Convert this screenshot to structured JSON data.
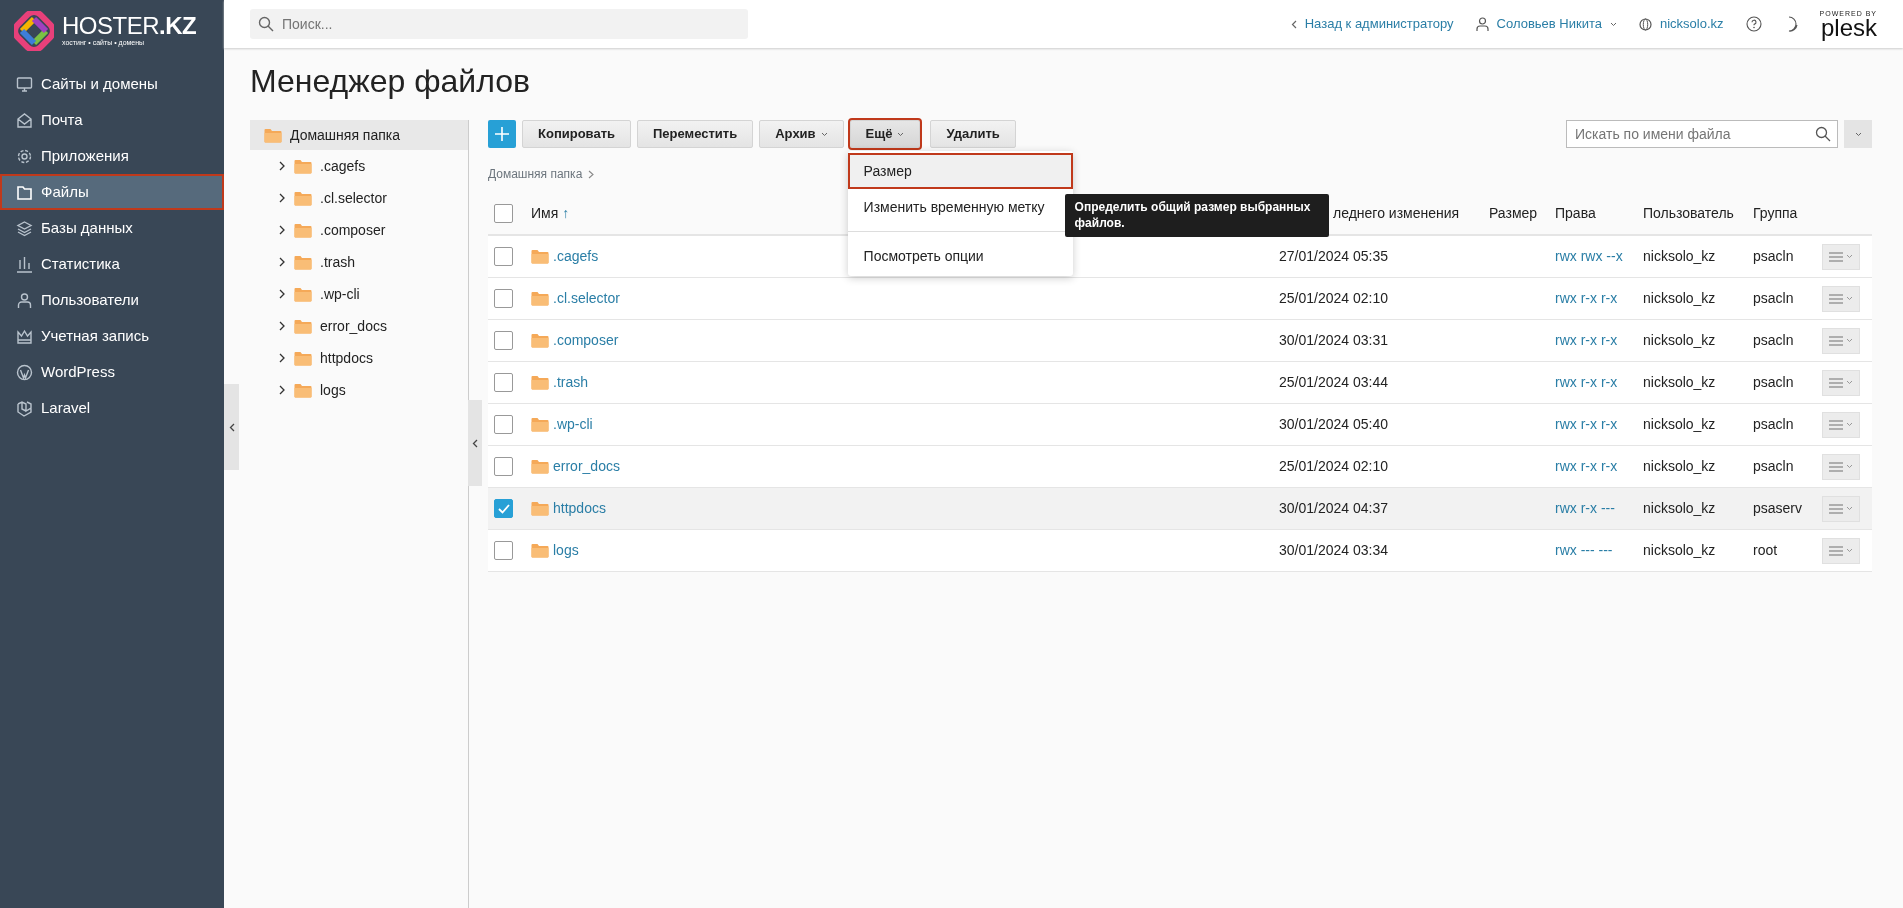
{
  "logo": {
    "brand": "HOSTER**.KZ**",
    "tagline": "хостинг • сайты • домены"
  },
  "sidebar": {
    "items": [
      {
        "label": "Сайты и домены",
        "kind": "monitor",
        "selected": false,
        "outlined": false
      },
      {
        "label": "Почта",
        "kind": "mail",
        "selected": false,
        "outlined": false
      },
      {
        "label": "Приложения",
        "kind": "gear",
        "selected": false,
        "outlined": false
      },
      {
        "label": "Файлы",
        "kind": "folder",
        "selected": true,
        "outlined": true
      },
      {
        "label": "Базы данных",
        "kind": "layers",
        "selected": false,
        "outlined": false
      },
      {
        "label": "Статистика",
        "kind": "chart",
        "selected": false,
        "outlined": false
      },
      {
        "label": "Пользователи",
        "kind": "user",
        "selected": false,
        "outlined": false
      },
      {
        "label": "Учетная запись",
        "kind": "crown",
        "selected": false,
        "outlined": false
      },
      {
        "label": "WordPress",
        "kind": "wordpress",
        "selected": false,
        "outlined": false
      },
      {
        "label": "Laravel",
        "kind": "laravel",
        "selected": false,
        "outlined": false
      }
    ]
  },
  "top_bar": {
    "search": {
      "placeholder": "Поиск..."
    },
    "back_link": "Назад к администратору",
    "user": "Соловьев Никита",
    "domain": "nicksolo.kz",
    "powered_by": "POWERED BY",
    "product": "plesk"
  },
  "page_title": "Менеджер файлов",
  "tree": {
    "root": {
      "label": "Домашняя папка",
      "selected": true,
      "children": [
        {
          "label": ".cagefs",
          "expanded": false
        },
        {
          "label": ".cl.selector",
          "expanded": false
        },
        {
          "label": ".composer",
          "expanded": false
        },
        {
          "label": ".trash",
          "expanded": false
        },
        {
          "label": ".wp-cli",
          "expanded": false
        },
        {
          "label": "error_docs",
          "expanded": false
        },
        {
          "label": "httpdocs",
          "expanded": false
        },
        {
          "label": "logs",
          "expanded": false
        }
      ]
    }
  },
  "toolbar": {
    "buttons": [
      {
        "kind": "add"
      },
      {
        "kind": "plain",
        "label": "Копировать",
        "outlined": false
      },
      {
        "kind": "plain",
        "label": "Переместить",
        "outlined": false
      },
      {
        "kind": "dropdown",
        "label": "Архив",
        "outlined": false,
        "expanded": false
      },
      {
        "kind": "dropdown",
        "label": "Ещё",
        "outlined": true,
        "expanded": true
      },
      {
        "kind": "plain",
        "label": "Удалить",
        "outlined": false
      }
    ],
    "file_search": {
      "placeholder": "Искать по имени файла"
    }
  },
  "dropdown_menu": {
    "groups": [
      [
        {
          "label": "Размер",
          "outlined": true
        },
        {
          "label": "Изменить временную метку",
          "outlined": false
        }
      ],
      [
        {
          "label": "Посмотреть опции",
          "outlined": false
        }
      ]
    ]
  },
  "tooltip": "Определить общий размер выбранных файлов.",
  "breadcrumb": [
    "Домашняя папка"
  ],
  "table": {
    "select_all": {
      "checked": false
    },
    "columns": [
      {
        "label": "Имя",
        "sort": "↑"
      },
      {
        "label": "леднего изменения"
      },
      {
        "label": "Размер"
      },
      {
        "label": "Права"
      },
      {
        "label": "Пользователь"
      },
      {
        "label": "Группа"
      }
    ],
    "rows": [
      {
        "name": ".cagefs",
        "modified": "27/01/2024 05:35",
        "rights": "rwx rwx --x",
        "user": "nicksolo_kz",
        "group": "psacln",
        "checked": false
      },
      {
        "name": ".cl.selector",
        "modified": "25/01/2024 02:10",
        "rights": "rwx r-x r-x",
        "user": "nicksolo_kz",
        "group": "psacln",
        "checked": false
      },
      {
        "name": ".composer",
        "modified": "30/01/2024 03:31",
        "rights": "rwx r-x r-x",
        "user": "nicksolo_kz",
        "group": "psacln",
        "checked": false
      },
      {
        "name": ".trash",
        "modified": "25/01/2024 03:44",
        "rights": "rwx r-x r-x",
        "user": "nicksolo_kz",
        "group": "psacln",
        "checked": false
      },
      {
        "name": ".wp-cli",
        "modified": "30/01/2024 05:40",
        "rights": "rwx r-x r-x",
        "user": "nicksolo_kz",
        "group": "psacln",
        "checked": false
      },
      {
        "name": "error_docs",
        "modified": "25/01/2024 02:10",
        "rights": "rwx r-x r-x",
        "user": "nicksolo_kz",
        "group": "psacln",
        "checked": false
      },
      {
        "name": "httpdocs",
        "modified": "30/01/2024 04:37",
        "rights": "rwx r-x ---",
        "user": "nicksolo_kz",
        "group": "psaserv",
        "checked": true
      },
      {
        "name": "logs",
        "modified": "30/01/2024 03:34",
        "rights": "rwx --- ---",
        "user": "nicksolo_kz",
        "group": "root",
        "checked": false
      }
    ]
  }
}
